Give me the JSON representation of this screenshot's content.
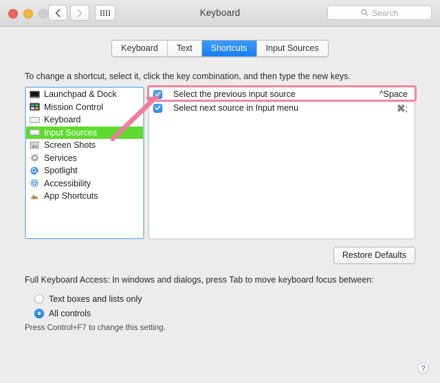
{
  "window": {
    "title": "Keyboard",
    "traffic_lights": [
      "close",
      "minimize",
      "zoom"
    ],
    "back_icon": "chevron-left-icon",
    "forward_icon": "chevron-right-icon",
    "grid_icon": "show-all-grid-icon"
  },
  "search": {
    "placeholder": "Search",
    "value": "",
    "icon": "search-icon"
  },
  "tabs": [
    {
      "label": "Keyboard",
      "active": false
    },
    {
      "label": "Text",
      "active": false
    },
    {
      "label": "Shortcuts",
      "active": true
    },
    {
      "label": "Input Sources",
      "active": false
    }
  ],
  "hint": "To change a shortcut, select it, click the key combination, and then type the new keys.",
  "sidebar": {
    "items": [
      {
        "label": "Launchpad & Dock",
        "icon": "launchpad-dock-icon",
        "selected": false
      },
      {
        "label": "Mission Control",
        "icon": "mission-control-icon",
        "selected": false
      },
      {
        "label": "Keyboard",
        "icon": "keyboard-icon",
        "selected": false
      },
      {
        "label": "Input Sources",
        "icon": "input-sources-icon",
        "selected": true
      },
      {
        "label": "Screen Shots",
        "icon": "screen-shots-icon",
        "selected": false
      },
      {
        "label": "Services",
        "icon": "services-gear-icon",
        "selected": false
      },
      {
        "label": "Spotlight",
        "icon": "spotlight-magnifier-icon",
        "selected": false
      },
      {
        "label": "Accessibility",
        "icon": "accessibility-icon",
        "selected": false
      },
      {
        "label": "App Shortcuts",
        "icon": "app-shortcuts-icon",
        "selected": false
      }
    ]
  },
  "shortcuts": {
    "rows": [
      {
        "name": "Select the previous input source",
        "key": "^Space",
        "checked": true,
        "highlighted": true
      },
      {
        "name": "Select next source in Input menu",
        "key": "⌘;",
        "checked": true,
        "highlighted": false
      }
    ]
  },
  "buttons": {
    "restore_defaults": "Restore Defaults",
    "help": "?"
  },
  "full_keyboard_access": {
    "title": "Full Keyboard Access: In windows and dialogs, press Tab to move keyboard focus between:",
    "options": [
      {
        "label": "Text boxes and lists only",
        "selected": false
      },
      {
        "label": "All controls",
        "selected": true
      }
    ],
    "footnote": "Press Control+F7 to change this setting."
  },
  "colors": {
    "accent_blue": "#1a7ef4",
    "selection_green": "#5ddc2e",
    "annotation_pink": "#f2859f",
    "focus_ring": "#9cc4e8"
  }
}
